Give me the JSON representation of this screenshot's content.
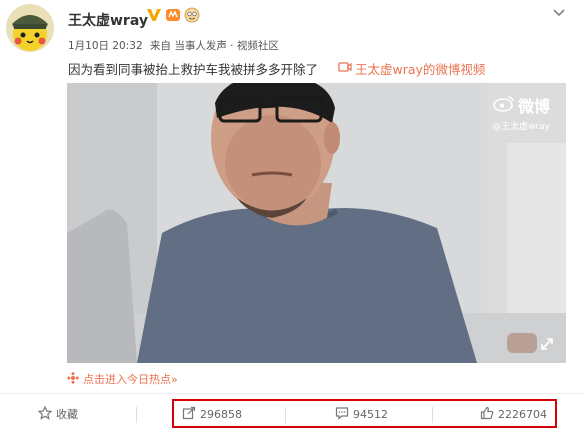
{
  "post": {
    "username": "王太虚wray",
    "date": "1月10日 20:32",
    "source": "来自 当事人发声 · 视频社区",
    "text": "因为看到同事被抬上救护车我被拼多多开除了",
    "video_link": "王太虚wray的微博视频"
  },
  "video": {
    "watermark_brand": "微博",
    "watermark_user": "@王太虚wray"
  },
  "hot_topic": "点击进入今日热点»",
  "actions": {
    "favorite_label": "收藏",
    "repost_count": "296858",
    "comment_count": "94512",
    "like_count": "2226704"
  },
  "colors": {
    "accent": "#eb7350",
    "highlight_border": "#d4000a",
    "verified": "#f5a800"
  },
  "icons": [
    "verified-v-icon",
    "badge-icon",
    "emoji-badge-icon",
    "more-icon",
    "video-icon",
    "weibo-logo-icon",
    "expand-icon",
    "hot-icon",
    "star-icon",
    "repost-icon",
    "comment-icon",
    "like-icon"
  ]
}
